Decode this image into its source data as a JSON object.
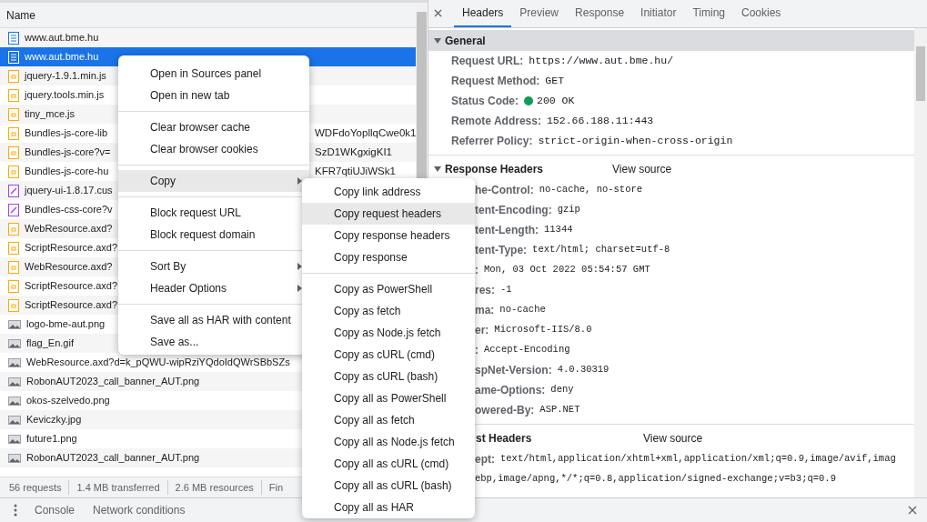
{
  "request_list": {
    "column": "Name",
    "rows": [
      {
        "name": "www.aut.bme.hu",
        "kind": "document",
        "selected": false
      },
      {
        "name": "www.aut.bme.hu",
        "kind": "document",
        "selected": true
      },
      {
        "name": "jquery-1.9.1.min.js",
        "kind": "script",
        "selected": false
      },
      {
        "name": "jquery.tools.min.js",
        "kind": "script",
        "selected": false
      },
      {
        "name": "tiny_mce.js",
        "kind": "script",
        "selected": false
      },
      {
        "name": "Bundles-js-core-lib",
        "kind": "script",
        "selected": false,
        "tail": "WDFdoYopllqCwe0k1"
      },
      {
        "name": "Bundles-js-core?v=",
        "kind": "script",
        "selected": false,
        "tail": "SzD1WKgxigKI1"
      },
      {
        "name": "Bundles-js-core-hu",
        "kind": "script",
        "selected": false,
        "tail": "KFR7qtiUJiWSk1"
      },
      {
        "name": "jquery-ui-1.8.17.cus",
        "kind": "stylesheet",
        "selected": false
      },
      {
        "name": "Bundles-css-core?v",
        "kind": "stylesheet",
        "selected": false
      },
      {
        "name": "WebResource.axd?",
        "kind": "script",
        "selected": false
      },
      {
        "name": "ScriptResource.axd?",
        "kind": "script",
        "selected": false
      },
      {
        "name": "WebResource.axd?",
        "kind": "script",
        "selected": false
      },
      {
        "name": "ScriptResource.axd?",
        "kind": "script",
        "selected": false
      },
      {
        "name": "ScriptResource.axd?",
        "kind": "script",
        "selected": false
      },
      {
        "name": "logo-bme-aut.png",
        "kind": "image",
        "selected": false
      },
      {
        "name": "flag_En.gif",
        "kind": "image",
        "selected": false
      },
      {
        "name": "WebResource.axd?d=k_pQWU-wipRziYQdoIdQWrSBbSZs",
        "kind": "image",
        "selected": false
      },
      {
        "name": "RobonAUT2023_call_banner_AUT.png",
        "kind": "image",
        "selected": false
      },
      {
        "name": "okos-szelvedo.png",
        "kind": "image",
        "selected": false
      },
      {
        "name": "Keviczky.jpg",
        "kind": "image",
        "selected": false
      },
      {
        "name": "future1.png",
        "kind": "image",
        "selected": false
      },
      {
        "name": "RobonAUT2023_call_banner_AUT.png",
        "kind": "image",
        "selected": false
      }
    ]
  },
  "status_bar": [
    "56 requests",
    "1.4 MB transferred",
    "2.6 MB resources",
    "Fin"
  ],
  "details": {
    "tabs": [
      {
        "label": "Headers",
        "selected": true
      },
      {
        "label": "Preview",
        "selected": false
      },
      {
        "label": "Response",
        "selected": false
      },
      {
        "label": "Initiator",
        "selected": false
      },
      {
        "label": "Timing",
        "selected": false
      },
      {
        "label": "Cookies",
        "selected": false
      }
    ],
    "sections": [
      {
        "title": "General",
        "expanded": true,
        "partly_hidden": false,
        "rows": [
          {
            "name": "Request URL:",
            "value": "https://www.aut.bme.hu/",
            "kind": "plain",
            "partly_hidden": false
          },
          {
            "name": "Request Method:",
            "value": "GET",
            "kind": "plain",
            "partly_hidden": false
          },
          {
            "name": "Status Code:",
            "value": "200 OK",
            "kind": "status",
            "partly_hidden": false
          },
          {
            "name": "Remote Address:",
            "value": "152.66.188.11:443",
            "kind": "plain",
            "partly_hidden": false
          },
          {
            "name": "Referrer Policy:",
            "value": "strict-origin-when-cross-origin",
            "kind": "plain",
            "partly_hidden": false
          }
        ]
      },
      {
        "title": "Response Headers",
        "view_source": "View source",
        "expanded": true,
        "partly_hidden": false,
        "rows": [
          {
            "name": "he-Control:",
            "value": "no-cache, no-store",
            "kind": "plain",
            "partly_hidden": true
          },
          {
            "name": "tent-Encoding:",
            "value": "gzip",
            "kind": "plain",
            "partly_hidden": true
          },
          {
            "name": "tent-Length:",
            "value": "11344",
            "kind": "plain",
            "partly_hidden": true
          },
          {
            "name": "tent-Type:",
            "value": "text/html; charset=utf-8",
            "kind": "plain",
            "partly_hidden": true
          },
          {
            "name": ":",
            "value": "Mon, 03 Oct 2022 05:54:57 GMT",
            "kind": "plain",
            "partly_hidden": true
          },
          {
            "name": "res:",
            "value": "-1",
            "kind": "plain",
            "partly_hidden": true
          },
          {
            "name": "ma:",
            "value": "no-cache",
            "kind": "plain",
            "partly_hidden": true
          },
          {
            "name": "er:",
            "value": "Microsoft-IIS/8.0",
            "kind": "plain",
            "partly_hidden": true
          },
          {
            "name": ":",
            "value": "Accept-Encoding",
            "kind": "plain",
            "partly_hidden": true
          },
          {
            "name": "spNet-Version:",
            "value": "4.0.30319",
            "kind": "plain",
            "partly_hidden": true
          },
          {
            "name": "ame-Options:",
            "value": "deny",
            "kind": "plain",
            "partly_hidden": true
          },
          {
            "name": "owered-By:",
            "value": "ASP.NET",
            "kind": "plain",
            "partly_hidden": true
          }
        ]
      },
      {
        "title": "st Headers",
        "view_source": "View source",
        "expanded": true,
        "partly_hidden": true,
        "rows": [
          {
            "name": "ept:",
            "value": "text/html,application/xhtml+xml,application/xml;q=0.9,image/avif,imag",
            "kind": "plain",
            "partly_hidden": true
          },
          {
            "value": "ebp,image/apng,*/*;q=0.8,application/signed-exchange;v=b3;q=0.9",
            "kind": "plain",
            "partly_hidden": true
          }
        ]
      }
    ]
  },
  "drawer": {
    "tabs": [
      "Console",
      "Network conditions"
    ]
  },
  "context_menu": {
    "groups": [
      [
        {
          "label": "Open in Sources panel",
          "selected": false,
          "has_submenu": false
        },
        {
          "label": "Open in new tab",
          "selected": false,
          "has_submenu": false
        }
      ],
      [
        {
          "label": "Clear browser cache",
          "selected": false,
          "has_submenu": false
        },
        {
          "label": "Clear browser cookies",
          "selected": false,
          "has_submenu": false
        }
      ],
      [
        {
          "label": "Copy",
          "selected": true,
          "has_submenu": true
        }
      ],
      [
        {
          "label": "Block request URL",
          "selected": false,
          "has_submenu": false
        },
        {
          "label": "Block request domain",
          "selected": false,
          "has_submenu": false
        }
      ],
      [
        {
          "label": "Sort By",
          "selected": false,
          "has_submenu": true
        },
        {
          "label": "Header Options",
          "selected": false,
          "has_submenu": true
        }
      ],
      [
        {
          "label": "Save all as HAR with content",
          "selected": false,
          "has_submenu": false
        },
        {
          "label": "Save as...",
          "selected": false,
          "has_submenu": false
        }
      ]
    ]
  },
  "copy_submenu": {
    "groups": [
      [
        {
          "label": "Copy link address",
          "selected": false
        },
        {
          "label": "Copy request headers",
          "selected": true
        },
        {
          "label": "Copy response headers",
          "selected": false
        },
        {
          "label": "Copy response",
          "selected": false
        }
      ],
      [
        {
          "label": "Copy as PowerShell",
          "selected": false
        },
        {
          "label": "Copy as fetch",
          "selected": false
        },
        {
          "label": "Copy as Node.js fetch",
          "selected": false
        },
        {
          "label": "Copy as cURL (cmd)",
          "selected": false
        },
        {
          "label": "Copy as cURL (bash)",
          "selected": false
        },
        {
          "label": "Copy all as PowerShell",
          "selected": false
        },
        {
          "label": "Copy all as fetch",
          "selected": false
        },
        {
          "label": "Copy all as Node.js fetch",
          "selected": false
        },
        {
          "label": "Copy all as cURL (cmd)",
          "selected": false
        },
        {
          "label": "Copy all as cURL (bash)",
          "selected": false
        },
        {
          "label": "Copy all as HAR",
          "selected": false
        }
      ]
    ]
  }
}
